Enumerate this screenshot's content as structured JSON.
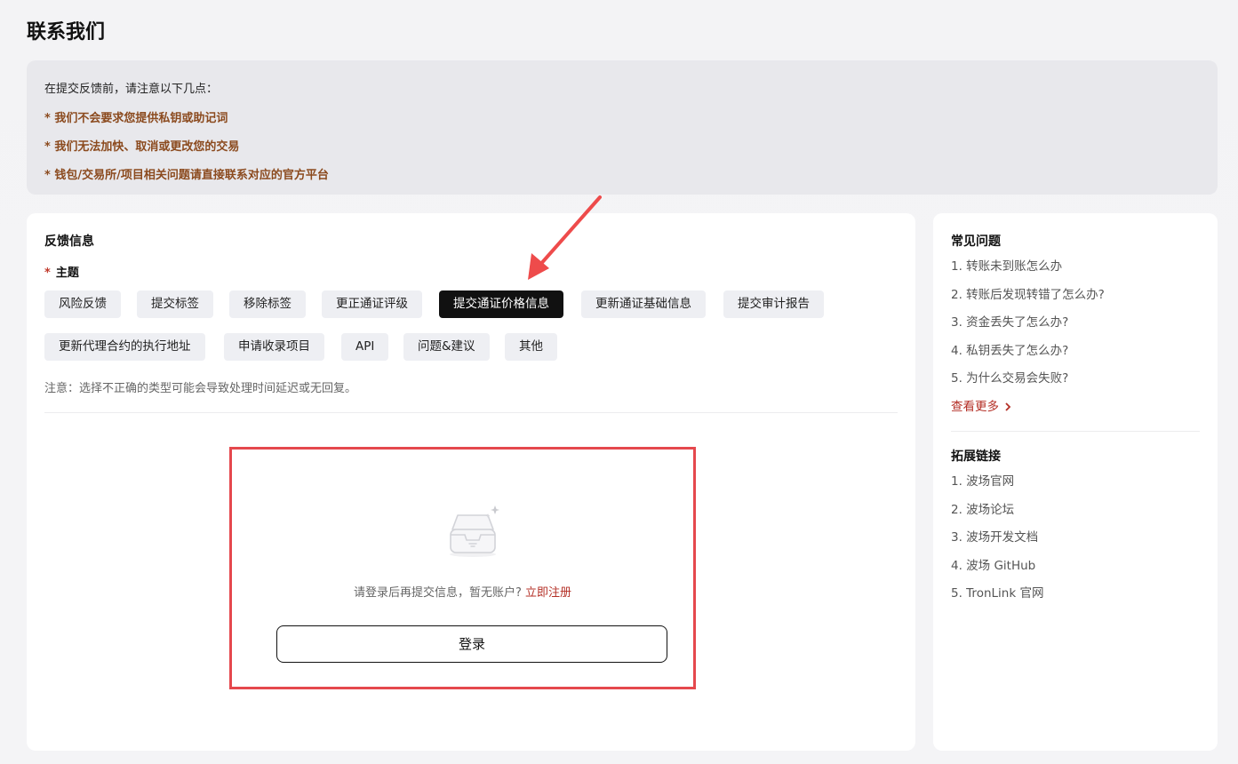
{
  "page": {
    "title": "联系我们"
  },
  "notice": {
    "intro": "在提交反馈前，请注意以下几点：",
    "lines": [
      "* 我们不会要求您提供私钥或助记词",
      "* 我们无法加快、取消或更改您的交易",
      "* 钱包/交易所/项目相关问题请直接联系对应的官方平台"
    ]
  },
  "feedback": {
    "title": "反馈信息",
    "subject_required": "*",
    "subject_label": "主题",
    "tags": [
      {
        "label": "风险反馈",
        "active": false
      },
      {
        "label": "提交标签",
        "active": false
      },
      {
        "label": "移除标签",
        "active": false
      },
      {
        "label": "更正通证评级",
        "active": false
      },
      {
        "label": "提交通证价格信息",
        "active": true
      },
      {
        "label": "更新通证基础信息",
        "active": false
      },
      {
        "label": "提交审计报告",
        "active": false
      },
      {
        "label": "更新代理合约的执行地址",
        "active": false
      },
      {
        "label": "申请收录项目",
        "active": false
      },
      {
        "label": "API",
        "active": false
      },
      {
        "label": "问题&建议",
        "active": false
      },
      {
        "label": "其他",
        "active": false
      }
    ],
    "note": "注意：选择不正确的类型可能会导致处理时间延迟或无回复。",
    "login_prompt": "请登录后再提交信息，暂无账户?",
    "register_link": "立即注册",
    "login_button": "登录"
  },
  "faq": {
    "title": "常见问题",
    "items": [
      "1. 转账未到账怎么办",
      "2. 转账后发现转错了怎么办?",
      "3. 资金丢失了怎么办?",
      "4. 私钥丢失了怎么办?",
      "5. 为什么交易会失败?"
    ],
    "more": "查看更多",
    "more_icon": "chevron-right-icon"
  },
  "links": {
    "title": "拓展链接",
    "items": [
      "1. 波场官网",
      "2. 波场论坛",
      "3. 波场开发文档",
      "4. 波场 GitHub",
      "5. TronLink 官网"
    ]
  },
  "colors": {
    "accent_red": "#e5484d",
    "link_red": "#b43027",
    "notice_brown": "#8b4a1e",
    "active_tag": "#111111"
  }
}
